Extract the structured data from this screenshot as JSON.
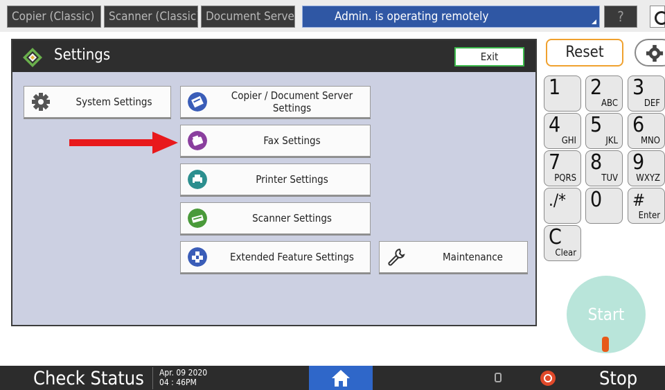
{
  "top_bar": {
    "tabs": [
      "Copier (Classic)",
      "Scanner (Classic)",
      "Document Server"
    ],
    "status": "Admin. is operating remotely",
    "help": "?"
  },
  "settings": {
    "title": "Settings",
    "exit_label": "Exit",
    "buttons": {
      "system": "System Settings",
      "copier": "Copier / Document Server Settings",
      "fax": "Fax Settings",
      "printer": "Printer Settings",
      "scanner": "Scanner Settings",
      "extended": "Extended Feature Settings",
      "maintenance": "Maintenance"
    }
  },
  "keypad": {
    "reset": "Reset",
    "keys": [
      {
        "d": "1",
        "s": ""
      },
      {
        "d": "2",
        "s": "ABC"
      },
      {
        "d": "3",
        "s": "DEF"
      },
      {
        "d": "4",
        "s": "GHI"
      },
      {
        "d": "5",
        "s": "JKL"
      },
      {
        "d": "6",
        "s": "MNO"
      },
      {
        "d": "7",
        "s": "PQRS"
      },
      {
        "d": "8",
        "s": "TUV"
      },
      {
        "d": "9",
        "s": "WXYZ"
      },
      {
        "d": "./*",
        "s": ""
      },
      {
        "d": "0",
        "s": ""
      },
      {
        "d": "#",
        "s": "Enter"
      },
      {
        "d": "C",
        "s": "Clear"
      }
    ],
    "start": "Start"
  },
  "bottom_bar": {
    "check_status": "Check Status",
    "date": "Apr. 09 2020",
    "time": "04 : 46PM",
    "stop": "Stop"
  },
  "colors": {
    "accent_blue": "#2f57a4",
    "exit_border": "#3bb84a",
    "reset_border": "#f0a12e",
    "arrow": "#e8191c",
    "start": "#b9e5da"
  }
}
